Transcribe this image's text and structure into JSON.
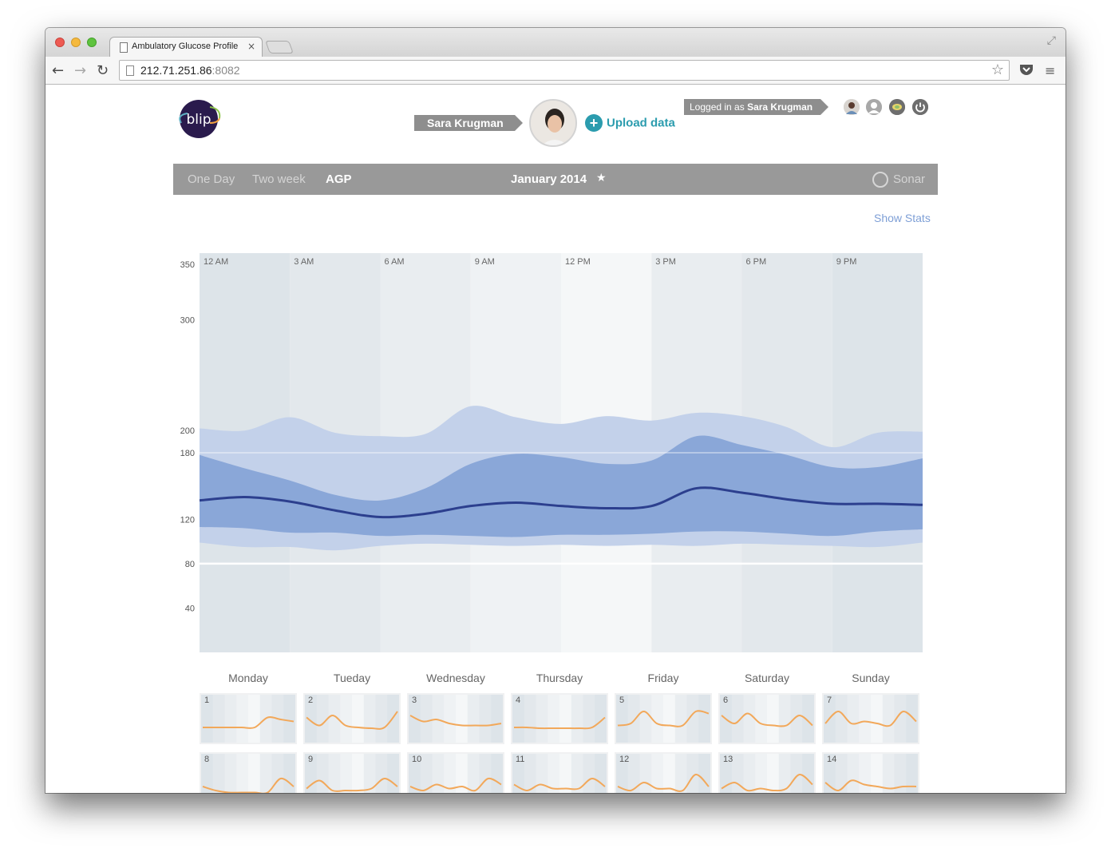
{
  "browser": {
    "tab_title": "Ambulatory Glucose Profile",
    "tab_close": "×",
    "url_host": "212.71.251.86",
    "url_port": ":8082"
  },
  "header": {
    "patient_name": "Sara Krugman",
    "upload_label": "Upload data",
    "logged_in_prefix": "Logged in as ",
    "logged_in_user": "Sara Krugman"
  },
  "navbar": {
    "tabs": [
      {
        "label": "One Day",
        "active": false
      },
      {
        "label": "Two week",
        "active": false
      },
      {
        "label": "AGP",
        "active": true
      }
    ],
    "date": "January 2014",
    "device": "Sonar"
  },
  "show_stats": "Show Stats",
  "chart_data": {
    "type": "area",
    "title": "",
    "x_ticks": [
      "12 AM",
      "3 AM",
      "6 AM",
      "9 AM",
      "12 PM",
      "3 PM",
      "6 PM",
      "9 PM"
    ],
    "y_ticks": [
      350,
      300,
      200,
      180,
      120,
      80,
      40
    ],
    "ylim": [
      0,
      360
    ],
    "target_lines": [
      180,
      80
    ],
    "x_hours": [
      0,
      1.5,
      3,
      4.5,
      6,
      7.5,
      9,
      10.5,
      12,
      13.5,
      15,
      16.5,
      18,
      19.5,
      21,
      22.5,
      24
    ],
    "series": [
      {
        "name": "",
        "role": "p90",
        "values": [
          202,
          200,
          212,
          198,
          195,
          197,
          222,
          212,
          206,
          213,
          209,
          216,
          213,
          203,
          185,
          198,
          199
        ]
      },
      {
        "name": "",
        "role": "p75",
        "values": [
          178,
          166,
          155,
          142,
          137,
          148,
          170,
          179,
          176,
          170,
          173,
          195,
          187,
          178,
          167,
          167,
          175
        ]
      },
      {
        "name": "",
        "role": "median",
        "values": [
          137,
          140,
          136,
          128,
          122,
          125,
          132,
          135,
          132,
          130,
          132,
          148,
          144,
          138,
          134,
          134,
          133
        ]
      },
      {
        "name": "",
        "role": "p25",
        "values": [
          113,
          112,
          108,
          108,
          105,
          106,
          105,
          104,
          106,
          106,
          107,
          109,
          109,
          107,
          105,
          109,
          111
        ]
      },
      {
        "name": "",
        "role": "p10",
        "values": [
          99,
          95,
          95,
          92,
          96,
          98,
          97,
          96,
          97,
          96,
          97,
          96,
          98,
          97,
          96,
          95,
          99
        ]
      }
    ]
  },
  "calendar": {
    "weekdays": [
      "Monday",
      "Tueday",
      "Wednesday",
      "Thursday",
      "Friday",
      "Saturday",
      "Sunday"
    ],
    "days": [
      {
        "label": "1",
        "values": [
          0.3,
          0.3,
          0.3,
          0.3,
          0.3,
          0.55,
          0.5,
          0.45
        ]
      },
      {
        "label": "2",
        "values": [
          0.55,
          0.35,
          0.6,
          0.35,
          0.3,
          0.28,
          0.3,
          0.7
        ]
      },
      {
        "label": "3",
        "values": [
          0.6,
          0.45,
          0.5,
          0.4,
          0.35,
          0.35,
          0.35,
          0.4
        ]
      },
      {
        "label": "4",
        "values": [
          0.3,
          0.3,
          0.28,
          0.28,
          0.28,
          0.28,
          0.3,
          0.55
        ]
      },
      {
        "label": "5",
        "values": [
          0.35,
          0.4,
          0.7,
          0.4,
          0.35,
          0.35,
          0.7,
          0.65
        ]
      },
      {
        "label": "6",
        "values": [
          0.6,
          0.4,
          0.65,
          0.4,
          0.35,
          0.35,
          0.6,
          0.35
        ]
      },
      {
        "label": "7",
        "values": [
          0.4,
          0.7,
          0.4,
          0.45,
          0.4,
          0.35,
          0.7,
          0.45
        ]
      },
      {
        "label": "8",
        "values": [
          0.3,
          0.2,
          0.15,
          0.15,
          0.15,
          0.15,
          0.5,
          0.3
        ]
      },
      {
        "label": "9",
        "values": [
          0.25,
          0.45,
          0.2,
          0.2,
          0.2,
          0.25,
          0.5,
          0.3
        ]
      },
      {
        "label": "10",
        "values": [
          0.3,
          0.2,
          0.35,
          0.25,
          0.3,
          0.2,
          0.5,
          0.35
        ]
      },
      {
        "label": "11",
        "values": [
          0.35,
          0.2,
          0.35,
          0.25,
          0.25,
          0.25,
          0.5,
          0.3
        ]
      },
      {
        "label": "12",
        "values": [
          0.3,
          0.2,
          0.4,
          0.25,
          0.25,
          0.2,
          0.6,
          0.3
        ]
      },
      {
        "label": "13",
        "values": [
          0.25,
          0.4,
          0.2,
          0.25,
          0.2,
          0.25,
          0.6,
          0.35
        ]
      },
      {
        "label": "14",
        "values": [
          0.4,
          0.2,
          0.45,
          0.35,
          0.3,
          0.25,
          0.3,
          0.3
        ]
      }
    ]
  },
  "colors": {
    "outer_band": "#c3d1ea",
    "inner_band": "#8aa7d8",
    "median": "#2c3f8e",
    "cgm_line": "#f2a85a",
    "chart_bg_dark": "#dde4e9",
    "chart_bg_light": "#f2f4f6"
  }
}
